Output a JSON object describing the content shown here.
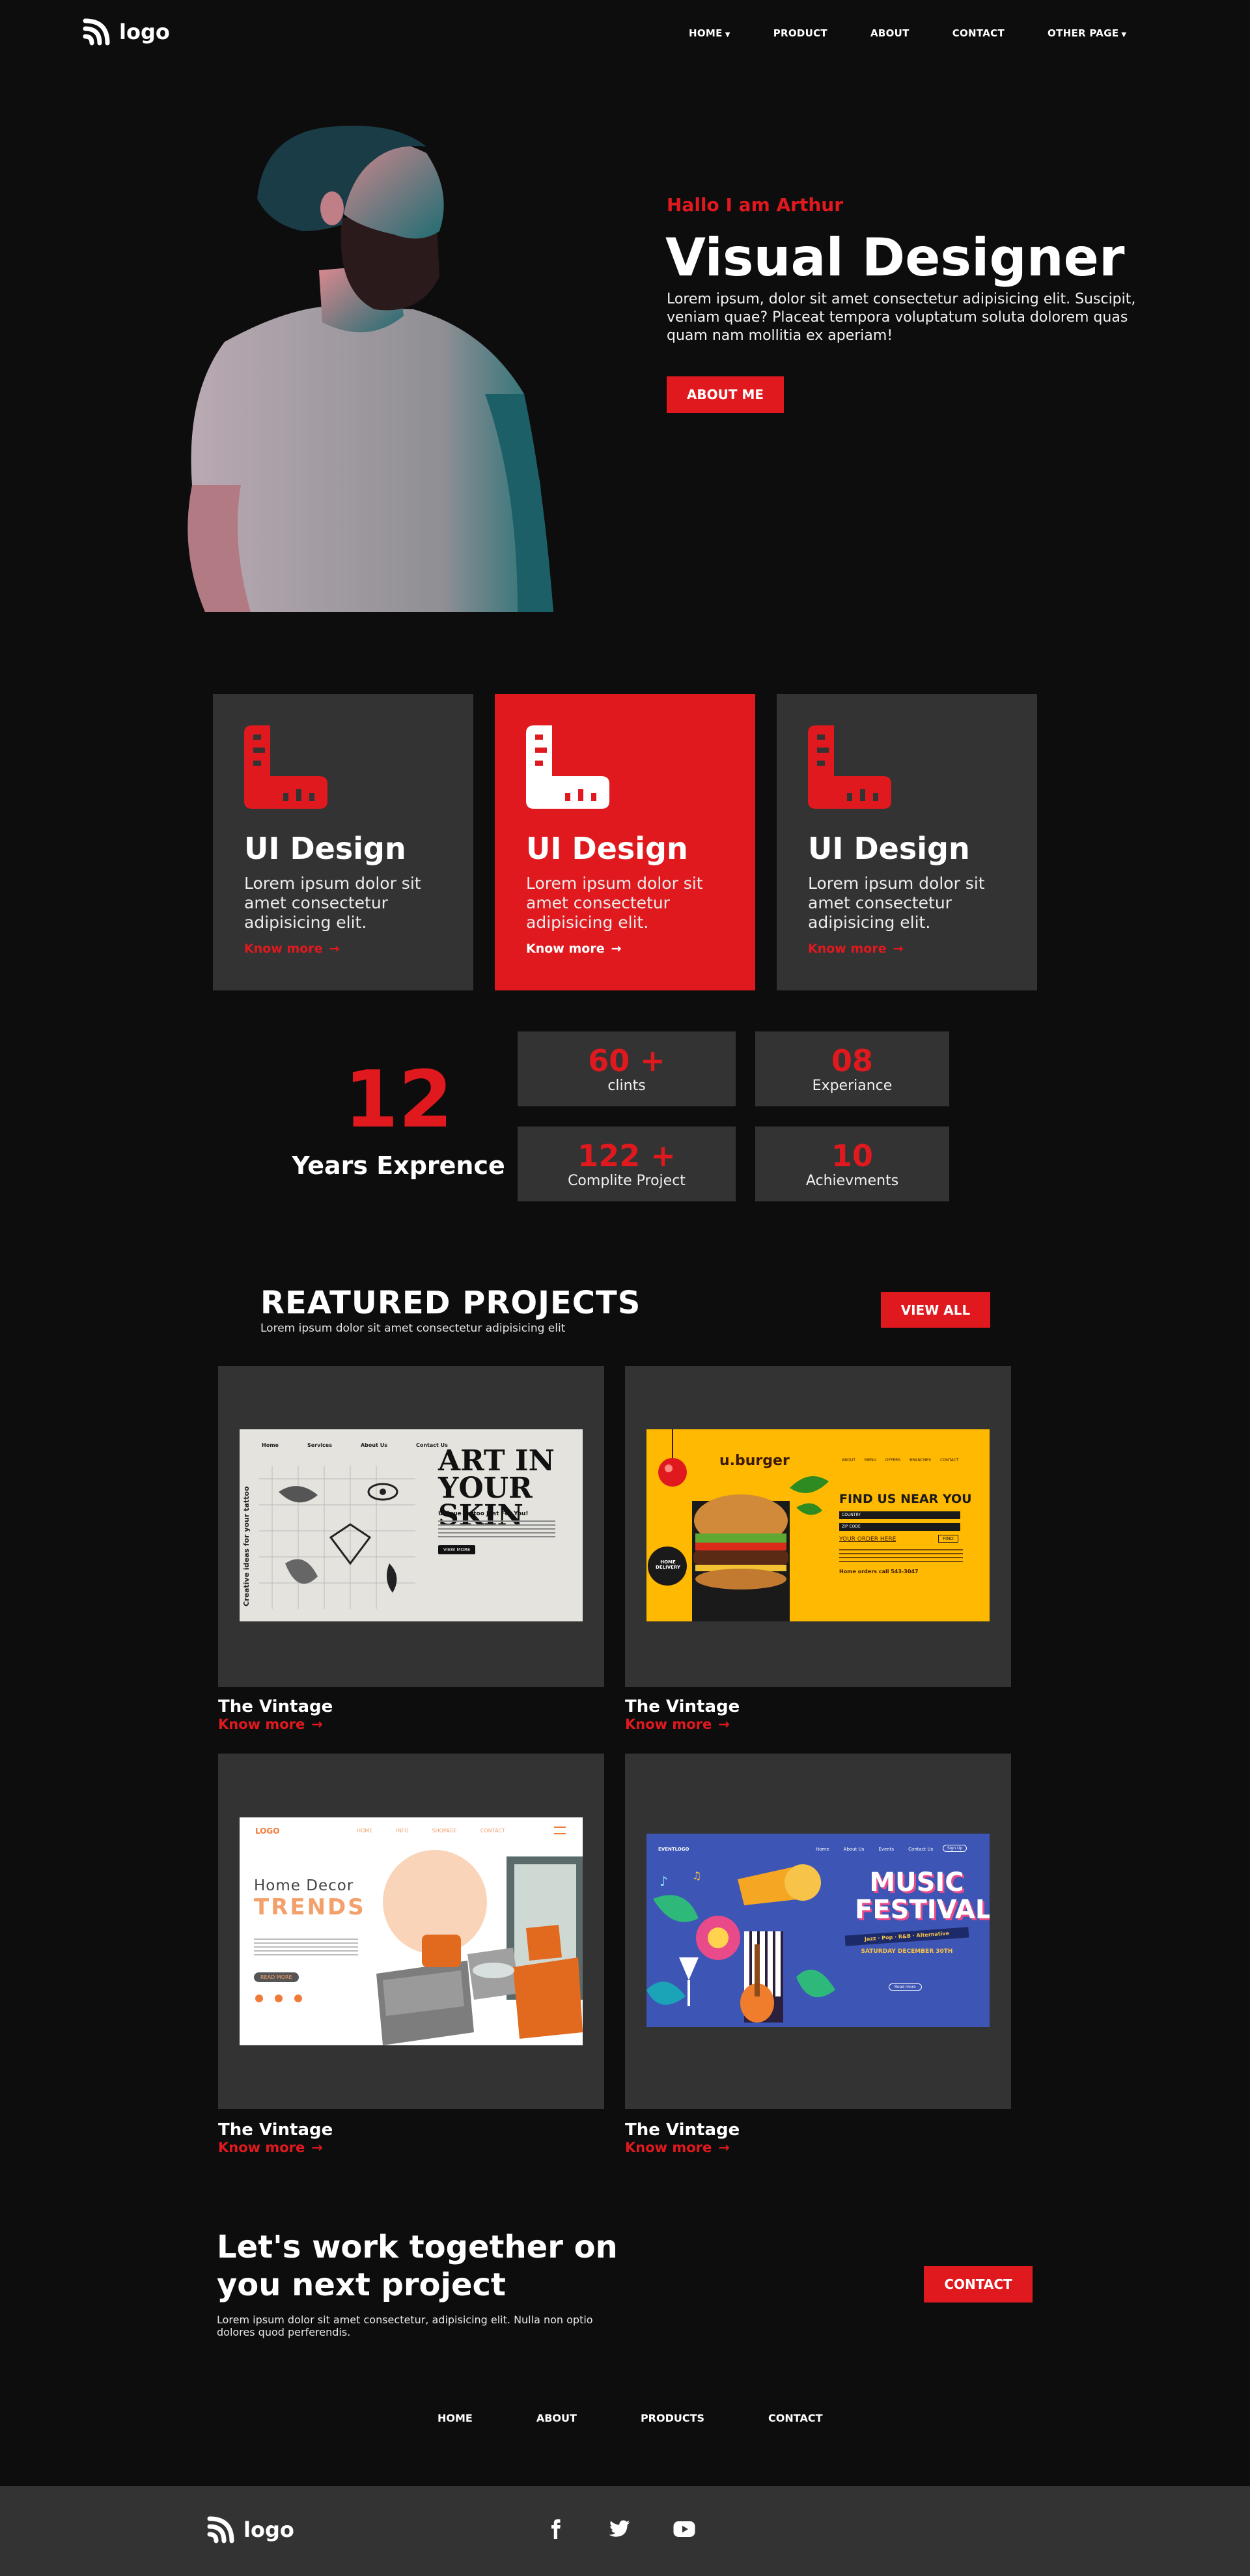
{
  "brand": {
    "logo_text": "logo"
  },
  "nav": {
    "items": [
      {
        "label": "HOME",
        "dropdown": true
      },
      {
        "label": "PRODUCT",
        "dropdown": false
      },
      {
        "label": "ABOUT",
        "dropdown": false
      },
      {
        "label": "CONTACT",
        "dropdown": false
      },
      {
        "label": "OTHER PAGE",
        "dropdown": true
      }
    ]
  },
  "hero": {
    "greeting": "Hallo I am Arthur",
    "title": "Visual Designer",
    "text": "Lorem ipsum, dolor sit amet consectetur adipisicing elit. Suscipit, veniam quae? Placeat tempora voluptatum soluta dolorem quas quam nam mollitia ex aperiam!",
    "button": "ABOUT ME"
  },
  "services": [
    {
      "title": "UI Design",
      "text": "Lorem ipsum dolor sit amet consectetur adipisicing elit.",
      "link": "Know more"
    },
    {
      "title": "UI Design",
      "text": "Lorem ipsum dolor sit amet consectetur adipisicing elit.",
      "link": "Know more"
    },
    {
      "title": "UI Design",
      "text": "Lorem ipsum dolor sit amet consectetur adipisicing elit.",
      "link": "Know more"
    }
  ],
  "experience": {
    "years": "12",
    "label": "Years Exprence",
    "stats": [
      {
        "value": "60 +",
        "label": "clints"
      },
      {
        "value": "08",
        "label": "Experiance"
      },
      {
        "value": "122 +",
        "label": "Complite Project"
      },
      {
        "value": "10",
        "label": "Achievments"
      }
    ]
  },
  "projects": {
    "heading": "REATURED PROJECTS",
    "subheading": "Lorem ipsum dolor sit amet consectetur adipisicing elit",
    "view_all": "VIEW ALL",
    "items": [
      {
        "title": "The Vintage",
        "link": "Know more",
        "thumb": {
          "nav": [
            "Home",
            "Services",
            "About Us",
            "Contact Us"
          ],
          "side": "Creative ideas for your tattoo",
          "headline": "ART IN YOUR SKIN",
          "sub": "Unique Tattoo Just For You!",
          "btn": "VIEW MORE"
        }
      },
      {
        "title": "The Vintage",
        "link": "Know more",
        "thumb": {
          "brand": "u.burger",
          "nav": [
            "ABOUT",
            "MENU",
            "OFFERS",
            "BRANCHES",
            "CONTACT"
          ],
          "headline": "FIND US NEAR YOU",
          "fields": [
            "COUNTRY",
            "ZIP CODE"
          ],
          "order": "YOUR ORDER HERE",
          "find": "FIND",
          "badge": "HOME DELIVERY",
          "phone": "Home orders call 543-3047"
        }
      },
      {
        "title": "The Vintage",
        "link": "Know more",
        "thumb": {
          "brand": "LOGO",
          "nav": [
            "HOME",
            "INFO",
            "SHOPAGE",
            "CONTACT"
          ],
          "line1": "Home Decor",
          "line2": "TRENDS",
          "btn": "READ MORE"
        }
      },
      {
        "title": "The Vintage",
        "link": "Know more",
        "thumb": {
          "brand": "EVENTLOGO",
          "nav": [
            "Home",
            "About Us",
            "Events",
            "Contact Us"
          ],
          "signup": "Sign Up",
          "line1": "MUSIC",
          "line2": "FESTIVAL",
          "genres": "Jazz · Pop · R&B · Alternative",
          "date": "SATURDAY DECEMBER 30TH",
          "btn": "Read more"
        }
      }
    ]
  },
  "cta": {
    "title_line1": "Let's work together on",
    "title_line2": "you next project",
    "text": "Lorem ipsum dolor sit amet consectetur, adipisicing elit. Nulla non optio dolores quod perferendis.",
    "button": "CONTACT"
  },
  "footer": {
    "nav": [
      "HOME",
      "ABOUT",
      "PRODUCTS",
      "CONTACT"
    ],
    "logo_text": "logo",
    "social": [
      "facebook-icon",
      "twitter-icon",
      "youtube-icon"
    ]
  },
  "colors": {
    "accent": "#e0191e",
    "background": "#0d0d0d",
    "card": "#333333"
  }
}
